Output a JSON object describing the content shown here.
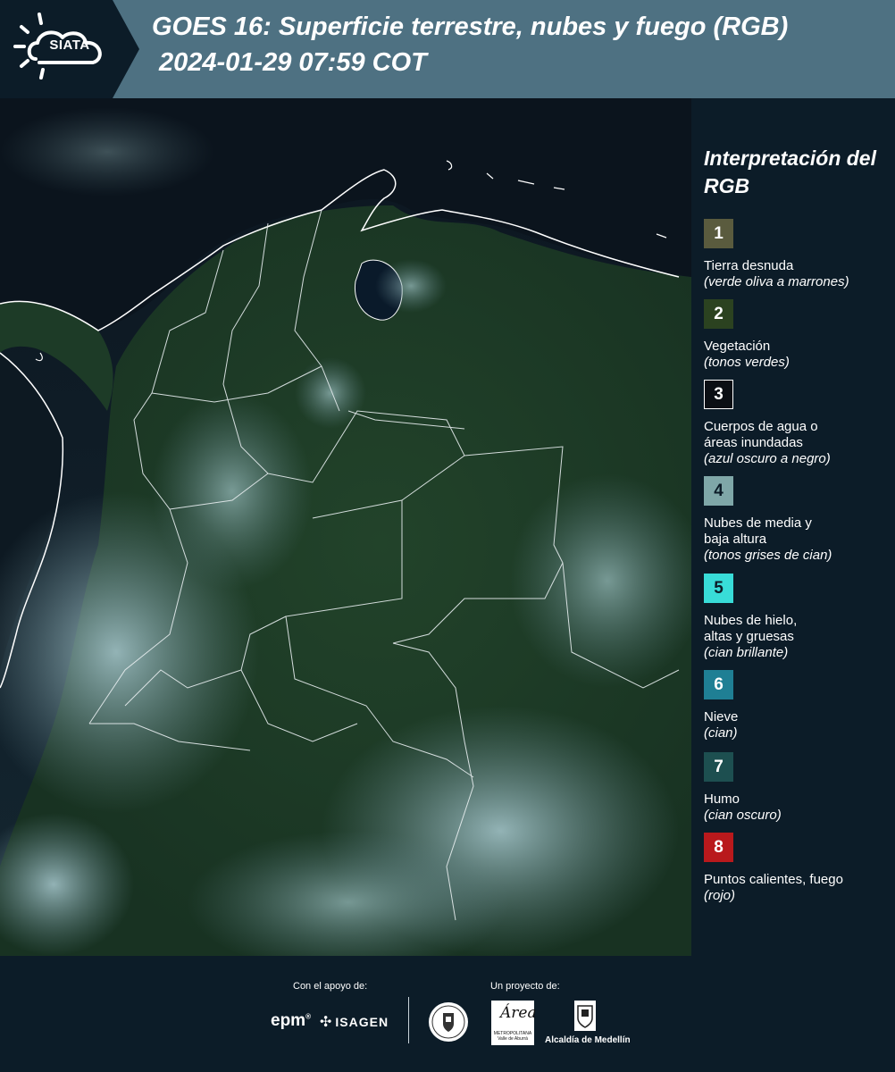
{
  "header": {
    "logo_text": "SIATA",
    "title_line1": "GOES 16: Superficie terrestre, nubes y fuego (RGB)",
    "title_line2": "2024-01-29 07:59 COT",
    "colors": {
      "banner": "#4e7182",
      "logo_panel": "#0c1c28"
    }
  },
  "map": {
    "image_type": "satellite-rgb-composite",
    "colors": {
      "vegetation": "#1f3a26",
      "ocean": "#0b141c",
      "cloud": "#8fb6bd",
      "border": "#ffffff"
    }
  },
  "legend": {
    "title": "Interpretación del RGB",
    "items": [
      {
        "number": "1",
        "label": "Tierra desnuda",
        "sub": "(verde oliva a marrones)",
        "color": "#5a5b3e"
      },
      {
        "number": "2",
        "label": "Vegetación",
        "sub": "(tonos verdes)",
        "color": "#2b4220"
      },
      {
        "number": "3",
        "label": "Cuerpos de agua o áreas inundadas",
        "sub": "(azul oscuro a negro)",
        "color": "#0b0f14"
      },
      {
        "number": "4",
        "label": "Nubes de media y baja altura",
        "sub": "(tonos grises de cian)",
        "color": "#7fa7a8"
      },
      {
        "number": "5",
        "label": "Nubes de hielo, altas y gruesas",
        "sub": "(cian brillante)",
        "color": "#38dcd8"
      },
      {
        "number": "6",
        "label": "Nieve",
        "sub": "(cian)",
        "color": "#1f7f94"
      },
      {
        "number": "7",
        "label": "Humo",
        "sub": "(cian oscuro)",
        "color": "#1d4f50"
      },
      {
        "number": "8",
        "label": "Puntos calientes, fuego",
        "sub": "(rojo)",
        "color": "#b9191c"
      }
    ]
  },
  "footer": {
    "support_label": "Con el apoyo de:",
    "project_label": "Un proyecto de:",
    "sponsors": {
      "epm": "epm",
      "isagen": "ISAGEN"
    },
    "amva": {
      "script": "Área",
      "small": "METROPOLITANA Valle de Aburrá"
    },
    "alcaldia": "Alcaldía de Medellín"
  }
}
